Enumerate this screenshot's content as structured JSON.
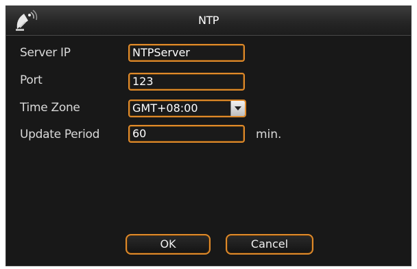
{
  "window": {
    "title": "NTP",
    "icon": "satellite-dish-icon"
  },
  "form": {
    "server_ip": {
      "label": "Server IP",
      "value": "NTPServer"
    },
    "port": {
      "label": "Port",
      "value": "123"
    },
    "time_zone": {
      "label": "Time Zone",
      "value": "GMT+08:00"
    },
    "update_period": {
      "label": "Update Period",
      "value": "60",
      "unit": "min."
    }
  },
  "buttons": {
    "ok_label": "OK",
    "cancel_label": "Cancel"
  },
  "colors": {
    "accent": "#e08a2a",
    "background": "#181818",
    "text": "#d9d9d9"
  }
}
